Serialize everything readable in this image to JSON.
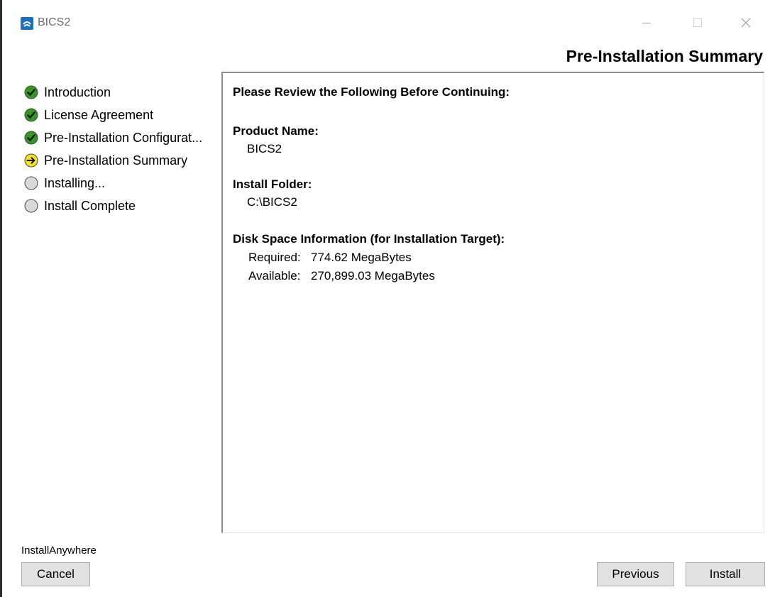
{
  "window": {
    "title": "BICS2",
    "icon": "bics2-app-icon"
  },
  "header": {
    "title": "Pre-Installation Summary"
  },
  "steps": [
    {
      "label": "Introduction",
      "status": "complete",
      "icon": "check-icon"
    },
    {
      "label": "License Agreement",
      "status": "complete",
      "icon": "check-icon"
    },
    {
      "label": "Pre-Installation Configurat...",
      "status": "complete",
      "icon": "check-icon"
    },
    {
      "label": "Pre-Installation Summary",
      "status": "current",
      "icon": "arrow-right-icon"
    },
    {
      "label": "Installing...",
      "status": "pending",
      "icon": "circle-icon"
    },
    {
      "label": "Install Complete",
      "status": "pending",
      "icon": "circle-icon"
    }
  ],
  "summary": {
    "intro": "Please Review the Following Before Continuing:",
    "product_name_label": "Product Name:",
    "product_name": "BICS2",
    "install_folder_label": "Install Folder:",
    "install_folder": "C:\\BICS2",
    "disk_space_label": "Disk Space Information (for Installation Target):",
    "required_label": "Required:",
    "required_value": "774.62 MegaBytes",
    "available_label": "Available:",
    "available_value": "270,899.03 MegaBytes"
  },
  "footer": {
    "brand": "InstallAnywhere",
    "cancel_label": "Cancel",
    "previous_label": "Previous",
    "install_label": "Install"
  },
  "colors": {
    "complete": "#2e9a1e",
    "current": "#f2e21a",
    "pending": "#d9d9d9",
    "button_bg": "#e1e1e1",
    "app_icon": "#1e6fc4"
  }
}
